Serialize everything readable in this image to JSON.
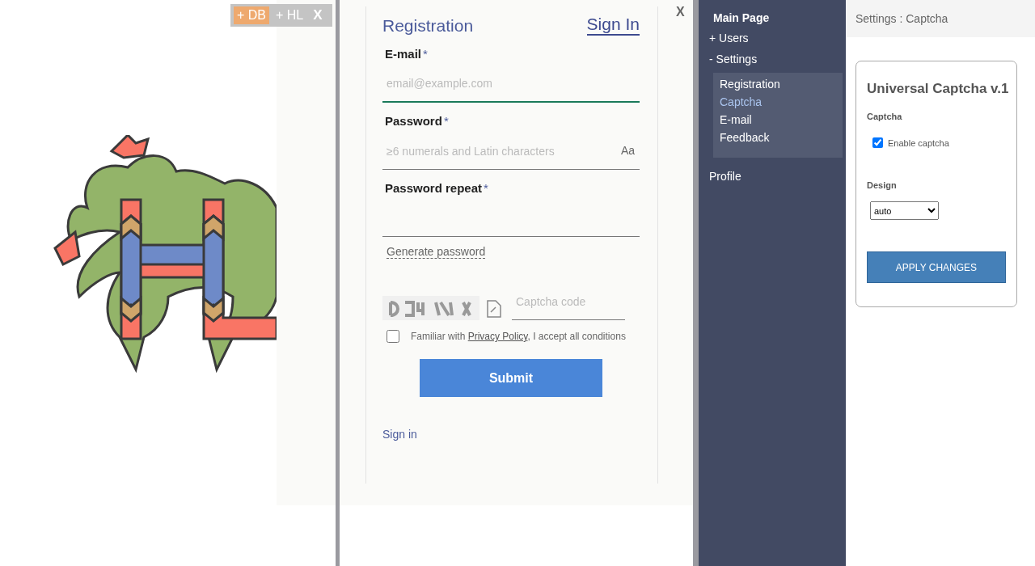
{
  "toolbar": {
    "buttons": [
      {
        "label": "+ DB",
        "selected": true
      },
      {
        "label": "+ HL",
        "selected": false
      }
    ],
    "close": "X"
  },
  "modal": {
    "close": "X",
    "title": "Registration",
    "switch_link": "Sign In",
    "fields": [
      {
        "label": "E-mail",
        "required_mark": "*",
        "placeholder": "email@example.com",
        "focused": true
      },
      {
        "label": "Password",
        "required_mark": "*",
        "placeholder": "≥6 numerals and Latin characters",
        "toggle": "Aa",
        "focused": false
      },
      {
        "label": "Password repeat",
        "required_mark": "*",
        "focused": false
      }
    ],
    "generate_link": "Generate password",
    "captcha": {
      "placeholder": "Captcha code"
    },
    "consent": {
      "checked": false,
      "before": "Familiar with",
      "link": "Privacy Policy",
      "after": ", I accept all conditions"
    },
    "submit": "Submit",
    "sign_in_link": "Sign in"
  },
  "sidebar": {
    "items": [
      {
        "label": "Main Page",
        "kind": "heading",
        "selected": false
      },
      {
        "label": "+ Users",
        "kind": "group",
        "selected": false
      },
      {
        "label": "- Settings",
        "kind": "group",
        "selected": false,
        "children": [
          {
            "label": "Registration",
            "selected": false
          },
          {
            "label": "Captcha",
            "selected": true
          },
          {
            "label": "E-mail",
            "selected": false
          },
          {
            "label": "Feedback",
            "selected": false
          }
        ]
      },
      {
        "label": "Profile",
        "kind": "link",
        "selected": false
      }
    ]
  },
  "breadcrumb": "Settings : Captcha",
  "card": {
    "title": "Universal Captcha v.1",
    "section": "Captcha",
    "checkbox": {
      "label": "Enable captcha",
      "checked": true
    },
    "design_label": "Design",
    "design_value": "auto",
    "button": "APPLY CHANGES"
  }
}
